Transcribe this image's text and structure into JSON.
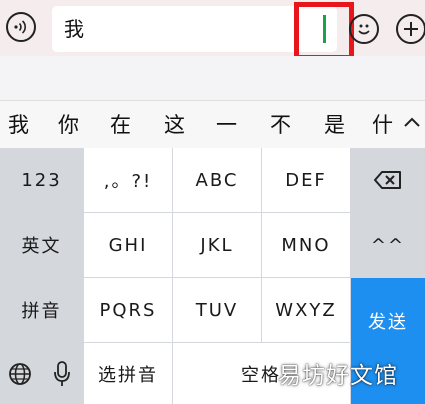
{
  "input_bar": {
    "text_value": "我"
  },
  "candidates": [
    "我",
    "你",
    "在",
    "这",
    "一",
    "不",
    "是",
    "什"
  ],
  "keyboard": {
    "row1": [
      "123",
      ",。?!",
      "ABC",
      "DEF"
    ],
    "row2": [
      "英文",
      "GHI",
      "JKL",
      "MNO",
      "^^"
    ],
    "row3": [
      "拼音",
      "PQRS",
      "TUV",
      "WXYZ"
    ],
    "row4_select": "选拼音",
    "space_label": "空格",
    "send_label": "发送"
  },
  "watermark": "易坊好文馆",
  "colors": {
    "highlight": "#e8161b",
    "caret": "#17a34a",
    "send": "#1d8ff0"
  },
  "icons": [
    "voice-icon",
    "emoji-icon",
    "plus-icon",
    "chevron-up-icon",
    "backspace-icon",
    "globe-icon",
    "microphone-icon"
  ]
}
